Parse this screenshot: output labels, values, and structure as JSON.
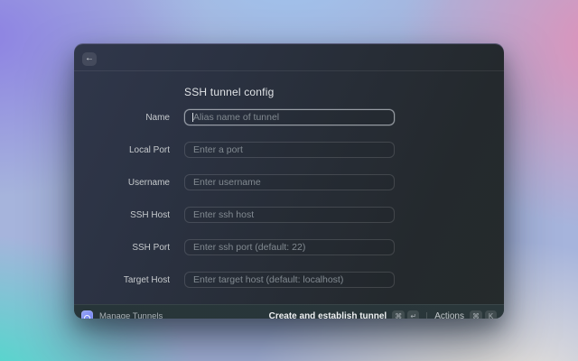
{
  "wallpaper": {
    "colors": {
      "purple": "#8c80e3",
      "blue": "#9ec5f0",
      "pink": "#e190b7",
      "teal": "#40dfc8",
      "cream": "#f3ebdb"
    }
  },
  "window": {
    "header": {
      "back_icon": "←"
    },
    "title": "SSH tunnel config",
    "form": {
      "fields": [
        {
          "label": "Name",
          "placeholder": "Alias name of tunnel",
          "focused": true
        },
        {
          "label": "Local Port",
          "placeholder": "Enter a port",
          "focused": false
        },
        {
          "label": "Username",
          "placeholder": "Enter username",
          "focused": false
        },
        {
          "label": "SSH Host",
          "placeholder": "Enter ssh host",
          "focused": false
        },
        {
          "label": "SSH Port",
          "placeholder": "Enter ssh port (default: 22)",
          "focused": false
        },
        {
          "label": "Target Host",
          "placeholder": "Enter target host (default: localhost)",
          "focused": false
        }
      ]
    },
    "footer": {
      "app_name": "Manage Tunnels",
      "app_icon_colors": {
        "from": "#9aa8f7",
        "to": "#6b7bee"
      },
      "primary_action": {
        "label": "Create and establish tunnel",
        "keys": [
          "⌘",
          "↵"
        ]
      },
      "secondary_action": {
        "label": "Actions",
        "keys": [
          "⌘",
          "K"
        ]
      }
    }
  }
}
